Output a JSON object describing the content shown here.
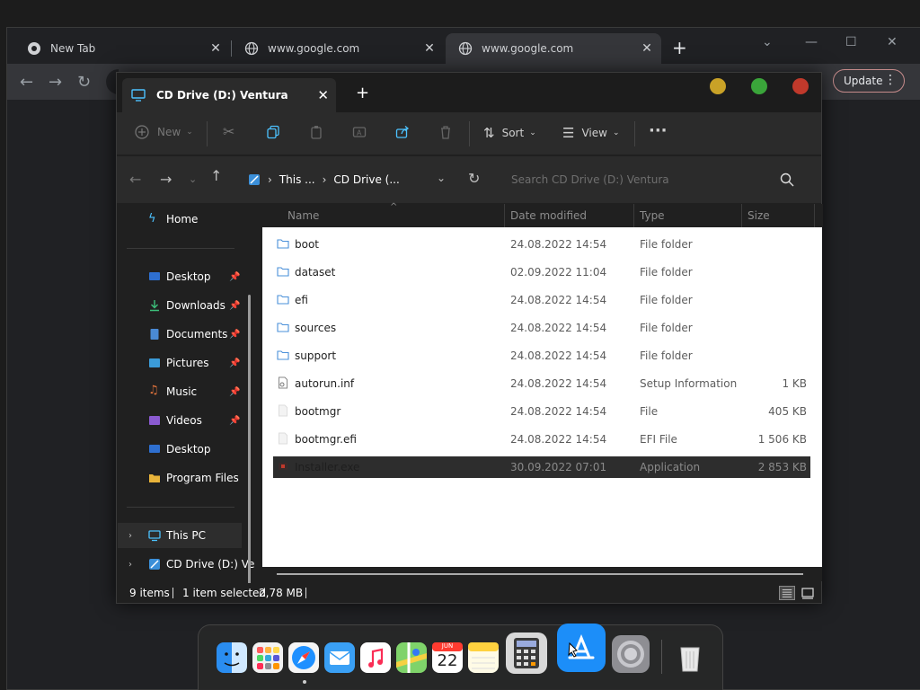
{
  "browser": {
    "tabs": [
      {
        "label": "New Tab"
      },
      {
        "label": "www.google.com"
      },
      {
        "label": "www.google.com"
      }
    ],
    "update_label": "Update"
  },
  "explorer": {
    "tab_title": "CD Drive (D:) Ventura",
    "cmd": {
      "new": "New",
      "sort": "Sort",
      "view": "View"
    },
    "breadcrumb": [
      "This ...",
      "CD Drive (..."
    ],
    "search_placeholder": "Search CD Drive (D:) Ventura",
    "columns": [
      "Name",
      "Date modified",
      "Type",
      "Size"
    ],
    "sidebar": {
      "home": "Home",
      "quick": [
        {
          "label": "Desktop",
          "icon": "desktop-icon",
          "pinned": true
        },
        {
          "label": "Downloads",
          "icon": "download-icon",
          "pinned": true
        },
        {
          "label": "Documents",
          "icon": "document-icon",
          "pinned": true
        },
        {
          "label": "Pictures",
          "icon": "picture-icon",
          "pinned": true
        },
        {
          "label": "Music",
          "icon": "music-icon",
          "pinned": true
        },
        {
          "label": "Videos",
          "icon": "video-icon",
          "pinned": true
        },
        {
          "label": "Desktop",
          "icon": "desktop-icon",
          "pinned": false
        },
        {
          "label": "Program Files",
          "icon": "folder-icon",
          "pinned": false
        }
      ],
      "this_pc": "This PC",
      "cd_drive": "CD Drive (D:) Ve"
    },
    "files": [
      {
        "name": "boot",
        "date": "24.08.2022 14:54",
        "type": "File folder",
        "size": "",
        "kind": "folder"
      },
      {
        "name": "dataset",
        "date": "02.09.2022 11:04",
        "type": "File folder",
        "size": "",
        "kind": "folder"
      },
      {
        "name": "efi",
        "date": "24.08.2022 14:54",
        "type": "File folder",
        "size": "",
        "kind": "folder"
      },
      {
        "name": "sources",
        "date": "24.08.2022 14:54",
        "type": "File folder",
        "size": "",
        "kind": "folder"
      },
      {
        "name": "support",
        "date": "24.08.2022 14:54",
        "type": "File folder",
        "size": "",
        "kind": "folder"
      },
      {
        "name": "autorun.inf",
        "date": "24.08.2022 14:54",
        "type": "Setup Information",
        "size": "1 KB",
        "kind": "setup"
      },
      {
        "name": "bootmgr",
        "date": "24.08.2022 14:54",
        "type": "File",
        "size": "405 KB",
        "kind": "file"
      },
      {
        "name": "bootmgr.efi",
        "date": "24.08.2022 14:54",
        "type": "EFI File",
        "size": "1 506 KB",
        "kind": "file"
      },
      {
        "name": "Installer.exe",
        "date": "30.09.2022 07:01",
        "type": "Application",
        "size": "2 853 KB",
        "kind": "app",
        "selected": true
      }
    ],
    "status": {
      "count": "9 items",
      "selection": "1 item selected",
      "size": "2,78 MB"
    }
  },
  "dock": {
    "calendar_month": "JUN",
    "calendar_day": "22"
  },
  "colors": {
    "accent": "#4cc2ff",
    "selection": "#2d2d2d",
    "folder": "#4a90d9"
  }
}
